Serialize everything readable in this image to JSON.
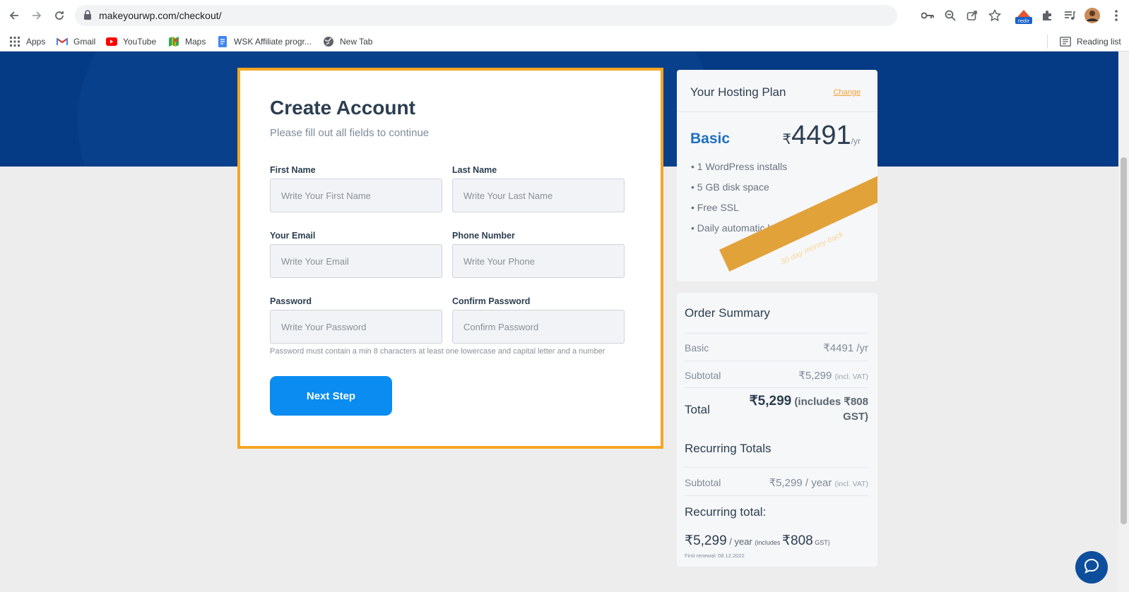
{
  "browser": {
    "url": "makeyourwp.com/checkout/",
    "bookmarks": [
      {
        "label": "Apps",
        "icon": "apps-grid-icon"
      },
      {
        "label": "Gmail",
        "icon": "gmail-icon"
      },
      {
        "label": "YouTube",
        "icon": "youtube-icon"
      },
      {
        "label": "Maps",
        "icon": "maps-icon"
      },
      {
        "label": "WSK Affiliate progr...",
        "icon": "docs-icon"
      },
      {
        "label": "New Tab",
        "icon": "globe-icon"
      }
    ],
    "reading_list": "Reading list",
    "extension_badge": "redir"
  },
  "form": {
    "title": "Create Account",
    "subtitle": "Please fill out all fields to continue",
    "fields": {
      "first_name": {
        "label": "First Name",
        "placeholder": "Write Your First Name"
      },
      "last_name": {
        "label": "Last Name",
        "placeholder": "Write Your Last Name"
      },
      "email": {
        "label": "Your Email",
        "placeholder": "Write Your Email"
      },
      "phone": {
        "label": "Phone Number",
        "placeholder": "Write Your Phone"
      },
      "password": {
        "label": "Password",
        "placeholder": "Write Your Password"
      },
      "confirm_password": {
        "label": "Confirm Password",
        "placeholder": "Confirm Password"
      }
    },
    "password_hint": "Password must contain a min 8 characters at least one lowercase and capital letter and a number",
    "next_button": "Next Step",
    "highlight_color": "#f5a623",
    "button_color": "#0a8cf0"
  },
  "plan": {
    "heading": "Your Hosting Plan",
    "change_link": "Change",
    "name": "Basic",
    "currency": "₹",
    "price": "4491",
    "period": "/yr",
    "features": [
      "• 1 WordPress installs",
      "• 5 GB disk space",
      "• Free SSL",
      "• Daily automatic backups"
    ],
    "ribbon": "30-day money-back"
  },
  "order": {
    "heading": "Order Summary",
    "basic_label": "Basic",
    "basic_value": "₹4491 /yr",
    "subtotal_label": "Subtotal",
    "subtotal_value": "₹5,299",
    "subtotal_note": "(incl. VAT)",
    "total_label": "Total",
    "total_value": "₹5,299",
    "total_note": "(includes ₹808 GST)",
    "recurring_heading": "Recurring Totals",
    "rec_subtotal_label": "Subtotal",
    "rec_subtotal_value": "₹5,299 / year",
    "rec_subtotal_note": "(incl. VAT)",
    "recurring_total_label": "Recurring total:",
    "recurring_amount": "₹5,299",
    "recurring_unit": " / year ",
    "recurring_includes": "(includes ",
    "recurring_gst_amount": "₹808",
    "recurring_gst_label": " GST)",
    "first_renewal": "First renewal: 08.12.2022"
  }
}
